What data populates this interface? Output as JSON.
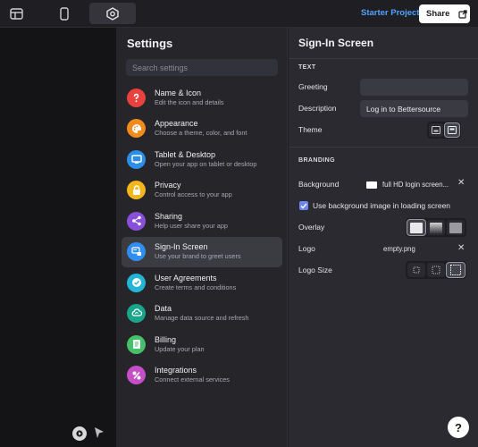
{
  "topbar": {
    "project_name": "Starter Project",
    "share_label": "Share"
  },
  "settings": {
    "title": "Settings",
    "search_placeholder": "Search settings",
    "items": [
      {
        "label": "Name & Icon",
        "desc": "Edit the icon and details",
        "icon": "question-icon",
        "color": "#e8413e"
      },
      {
        "label": "Appearance",
        "desc": "Choose a theme, color, and font",
        "icon": "palette-icon",
        "color": "#f28b1e"
      },
      {
        "label": "Tablet & Desktop",
        "desc": "Open your app on tablet or desktop",
        "icon": "monitor-icon",
        "color": "#2d8ee8"
      },
      {
        "label": "Privacy",
        "desc": "Control access to your app",
        "icon": "lock-icon",
        "color": "#f3b71b"
      },
      {
        "label": "Sharing",
        "desc": "Help user share your app",
        "icon": "share-icon",
        "color": "#8a4fd8"
      },
      {
        "label": "Sign-In Screen",
        "desc": "Use your brand to greet users",
        "icon": "signin-icon",
        "color": "#2f8ef0"
      },
      {
        "label": "User Agreements",
        "desc": "Create terms and conditions",
        "icon": "check-circle-icon",
        "color": "#22b5d6"
      },
      {
        "label": "Data",
        "desc": "Manage data source and refresh",
        "icon": "data-sync-icon",
        "color": "#1aa58a"
      },
      {
        "label": "Billing",
        "desc": "Update your plan",
        "icon": "billing-icon",
        "color": "#46c06a"
      },
      {
        "label": "Integrations",
        "desc": "Connect external services",
        "icon": "integrations-icon",
        "color": "#c64fc8"
      }
    ]
  },
  "signin": {
    "title": "Sign-In Screen",
    "text_section": "TEXT",
    "greeting_label": "Greeting",
    "greeting_value": "",
    "description_label": "Description",
    "description_value": "Log in to Bettersource",
    "theme_label": "Theme",
    "branding_section": "BRANDING",
    "background_label": "Background",
    "background_file": "full HD login screen...",
    "use_bg_loading_label": "Use background image in loading screen",
    "use_bg_loading_checked": true,
    "overlay_label": "Overlay",
    "logo_label": "Logo",
    "logo_file": "empty.png",
    "logo_size_label": "Logo Size"
  },
  "help_label": "?"
}
